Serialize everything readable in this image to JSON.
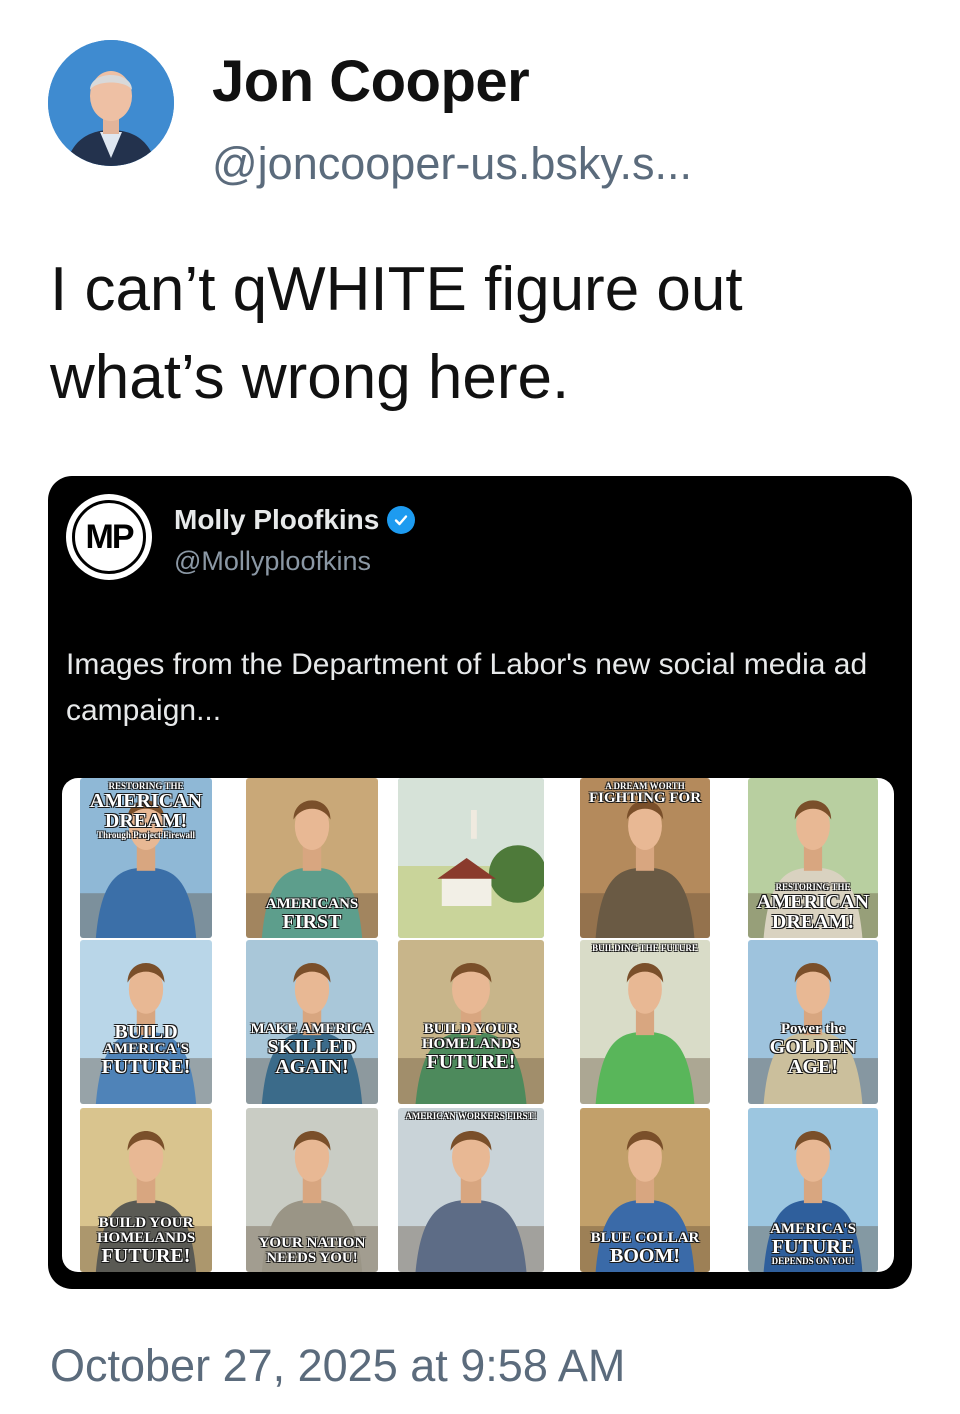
{
  "post": {
    "author_name": "Jon Cooper",
    "author_handle": "@joncooper-us.bsky.s...",
    "text": "I can’t qWHITE figure out what’s wrong here.",
    "timestamp": "October 27, 2025 at 9:58 AM",
    "avatar_icon": "profile-photo"
  },
  "embed": {
    "logo_text": "MP",
    "author_name": "Molly Ploofkins",
    "verified_icon": "verified-badge-icon",
    "author_handle": "@Mollyploofkins",
    "text": "Images from the Department of Labor's new social media ad campaign..."
  },
  "posters": [
    {
      "lines": [
        "RESTORING THE",
        "AMERICAN",
        "DREAM!",
        "Through Project Firewall"
      ]
    },
    {
      "lines": [
        "AMERICANS",
        "FIRST"
      ]
    },
    {
      "lines": []
    },
    {
      "lines": [
        "A DREAM WORTH",
        "FIGHTING FOR"
      ]
    },
    {
      "lines": [
        "RESTORING THE",
        "AMERICAN",
        "DREAM!"
      ]
    },
    {
      "lines": [
        "BUILD",
        "AMERICA'S",
        "FUTURE!"
      ]
    },
    {
      "lines": [
        "MAKE AMERICA",
        "SKILLED",
        "AGAIN!"
      ]
    },
    {
      "lines": [
        "BUILD YOUR",
        "HOMELANDS",
        "FUTURE!"
      ]
    },
    {
      "lines": [
        "BUILDING THE FUTURE"
      ]
    },
    {
      "lines": [
        "Power the",
        "GOLDEN",
        "AGE!"
      ]
    },
    {
      "lines": [
        "BUILD YOUR",
        "HOMELANDS",
        "FUTURE!"
      ]
    },
    {
      "lines": [
        "YOUR NATION",
        "NEEDS YOU!"
      ]
    },
    {
      "lines": [
        "AMERICAN WORKERS FIRST!"
      ]
    },
    {
      "lines": [
        "BLUE COLLAR",
        "BOOM!"
      ]
    },
    {
      "lines": [
        "AMERICA'S",
        "FUTURE",
        "DEPENDS ON YOU!"
      ]
    }
  ]
}
